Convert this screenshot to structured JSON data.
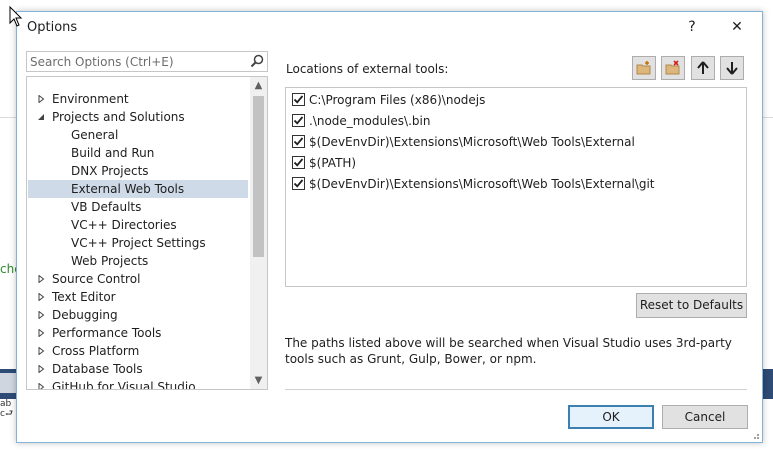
{
  "dialog": {
    "title": "Options",
    "help_button": "?",
    "close_button": "✕",
    "search_placeholder": "Search Options (Ctrl+E)",
    "tree": [
      {
        "label": "Environment",
        "level": 0,
        "expanded": false
      },
      {
        "label": "Projects and Solutions",
        "level": 0,
        "expanded": true
      },
      {
        "label": "General",
        "level": 1
      },
      {
        "label": "Build and Run",
        "level": 1
      },
      {
        "label": "DNX Projects",
        "level": 1
      },
      {
        "label": "External Web Tools",
        "level": 1,
        "selected": true
      },
      {
        "label": "VB Defaults",
        "level": 1
      },
      {
        "label": "VC++ Directories",
        "level": 1
      },
      {
        "label": "VC++ Project Settings",
        "level": 1
      },
      {
        "label": "Web Projects",
        "level": 1
      },
      {
        "label": "Source Control",
        "level": 0,
        "expanded": false
      },
      {
        "label": "Text Editor",
        "level": 0,
        "expanded": false
      },
      {
        "label": "Debugging",
        "level": 0,
        "expanded": false
      },
      {
        "label": "Performance Tools",
        "level": 0,
        "expanded": false
      },
      {
        "label": "Cross Platform",
        "level": 0,
        "expanded": false
      },
      {
        "label": "Database Tools",
        "level": 0,
        "expanded": false
      },
      {
        "label": "GitHub for Visual Studio",
        "level": 0,
        "expanded": false
      }
    ],
    "locations_label": "Locations of external tools:",
    "toolbar_icons": [
      "new-folder-icon",
      "delete-folder-icon",
      "arrow-up-icon",
      "arrow-down-icon"
    ],
    "paths": [
      {
        "text": "C:\\Program Files (x86)\\nodejs",
        "checked": true
      },
      {
        "text": ".\\node_modules\\.bin",
        "checked": true
      },
      {
        "text": "$(DevEnvDir)\\Extensions\\Microsoft\\Web Tools\\External",
        "checked": true
      },
      {
        "text": "$(PATH)",
        "checked": true
      },
      {
        "text": "$(DevEnvDir)\\Extensions\\Microsoft\\Web Tools\\External\\git",
        "checked": true
      }
    ],
    "reset_button": "Reset to Defaults",
    "description": "The paths listed above will be searched when Visual Studio uses 3rd-party tools such as Grunt, Gulp, Bower, or npm.",
    "ok_button": "OK",
    "cancel_button": "Cancel"
  },
  "background": {
    "partial_text": "che"
  },
  "colors": {
    "selection": "#cfdae8",
    "accent_border": "#3c7fb1",
    "window_border": "#83b4d8"
  }
}
